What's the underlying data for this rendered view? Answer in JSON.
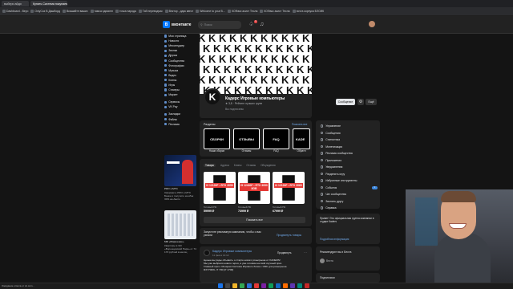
{
  "browser": {
    "tabs": [
      {
        "title": "выбери айди"
      },
      {
        "title": "Купить Система покупаемые"
      },
      {
        "title": "…"
      }
    ],
    "bookmarks": [
      "Dashboard - Beyo",
      "OnlyCoz B Дашборд",
      "Вкашайте ваших",
      "тамса эдомитн",
      "точка народа",
      "Таб переводчик",
      "Вектор - дарк квест",
      "Welcome to your B…",
      "КОФакс асист Тесла",
      "КОФакс асист Тесла",
      "почта корпуса БЛОИК"
    ]
  },
  "vk": {
    "logo_text": "вконтакте",
    "search_placeholder": "Поиск",
    "notif_count": "1",
    "sidebar": {
      "items": [
        "Моя страница",
        "Новости",
        "Мессенджер",
        "Звонки",
        "Друзья",
        "Сообщества",
        "Фотографии",
        "Музыка",
        "Видео",
        "Клипы",
        "Игры",
        "Стикеры",
        "Маркет"
      ],
      "items2": [
        "Сервисы",
        "VK Pay"
      ],
      "items3": [
        "Закладки",
        "Файлы",
        "Реклама"
      ]
    },
    "ads": [
      {
        "title": "PRO и МТС",
        "text": "Оформите PRO и МТС Банке и получите кешбэк 30% на Авито"
      },
      {
        "title": "МФ «Маршение»",
        "text": "Квартиры в ЖК «Воронцовский Парк» от 74 170 рублей в месяц"
      }
    ],
    "group": {
      "cover_letter": "K",
      "name": "Кадерс Игровые компьютеры",
      "rating": "★ 3,8 · Рейтинг лучших групп",
      "followers": "Вы подписаны",
      "msg_button": "Сообщение",
      "more_button": "Ещё"
    },
    "sections": {
      "header": "Разделы",
      "show_all": "Показать все",
      "tiles": [
        {
          "tile": "СБОРКИ",
          "label": "Наши сборки"
        },
        {
          "tile": "ОТЗЫВЫ",
          "label": "Отзывы"
        },
        {
          "tile": "FAQ",
          "label": "FAQ"
        },
        {
          "tile": "KADE",
          "label": "Обратн"
        }
      ]
    },
    "product_tabs": [
      "Товары",
      "Адреса",
      "Клипы",
      "Отзывы",
      "Обсуждения"
    ],
    "products": [
      {
        "label": "I3 12100F • RTX 3050",
        "caption": "Готовый ПК",
        "price": "59999 ₽"
      },
      {
        "label": "I5 12400F • RTX 3050 8GB",
        "caption": "Готовый ПК",
        "price": "73999 ₽"
      },
      {
        "label": "I3 12100F • RTX 3060",
        "caption": "Готовый ПК",
        "price": "67999 ₽"
      }
    ],
    "show_all_products": "Показать все",
    "promo": {
      "text": "Запустите рекламную кампанию, чтобы о вас узнали",
      "link": "Продвинуть товары"
    },
    "post": {
      "author": "Кадерс Игровые компьютеры",
      "time": "11 фев в 14:12",
      "action": "Продвинуть",
      "text1": "Ценые вы рады объявить о старте нового розыгрыша от KADERS!",
      "text2": "Мы уже выбрали нового героя, а уже готовим на свой скучный приз",
      "text3": "Главный приз • Мощная Система Игрового блока • CBC для розыгрыша",
      "text4": "RX7700XL I7 700 [i7 1700]"
    },
    "right_menu": [
      "Управление",
      "Сообщения",
      "Статистика",
      "Монетизация",
      "Реклама сообщества",
      "Приложения",
      "Уведомления",
      "Разделить игру",
      "Избранные инструменты",
      "События",
      "Чат сообщества",
      "Звонить другу",
      "Справка"
    ],
    "right_badge": "1",
    "right_promo": {
      "text": "Привет! Это официальная группа компании в студии Kaders",
      "link": "Подробная информация"
    },
    "recommend": {
      "title": "Рекомендуют вы и Беста",
      "name": "Веста"
    },
    "followers_title": "Подписчики"
  },
  "statusbar": "Ожидание ответа от vk.com…"
}
